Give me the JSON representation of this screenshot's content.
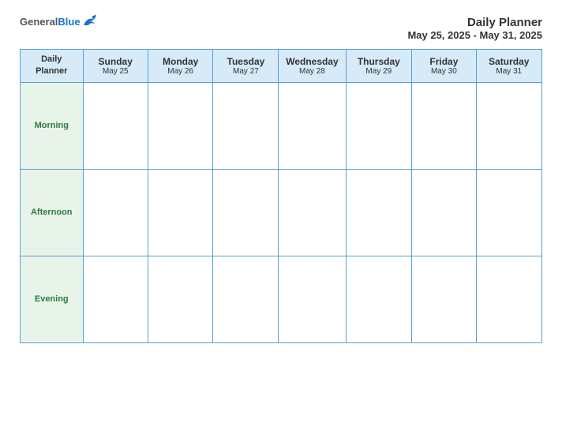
{
  "header": {
    "logo": {
      "general": "General",
      "blue": "Blue"
    },
    "title": "Daily Planner",
    "date_range": "May 25, 2025 - May 31, 2025"
  },
  "table": {
    "top_left": {
      "line1": "Daily",
      "line2": "Planner"
    },
    "columns": [
      {
        "day": "Sunday",
        "date": "May 25"
      },
      {
        "day": "Monday",
        "date": "May 26"
      },
      {
        "day": "Tuesday",
        "date": "May 27"
      },
      {
        "day": "Wednesday",
        "date": "May 28"
      },
      {
        "day": "Thursday",
        "date": "May 29"
      },
      {
        "day": "Friday",
        "date": "May 30"
      },
      {
        "day": "Saturday",
        "date": "May 31"
      }
    ],
    "rows": [
      {
        "label": "Morning"
      },
      {
        "label": "Afternoon"
      },
      {
        "label": "Evening"
      }
    ]
  }
}
